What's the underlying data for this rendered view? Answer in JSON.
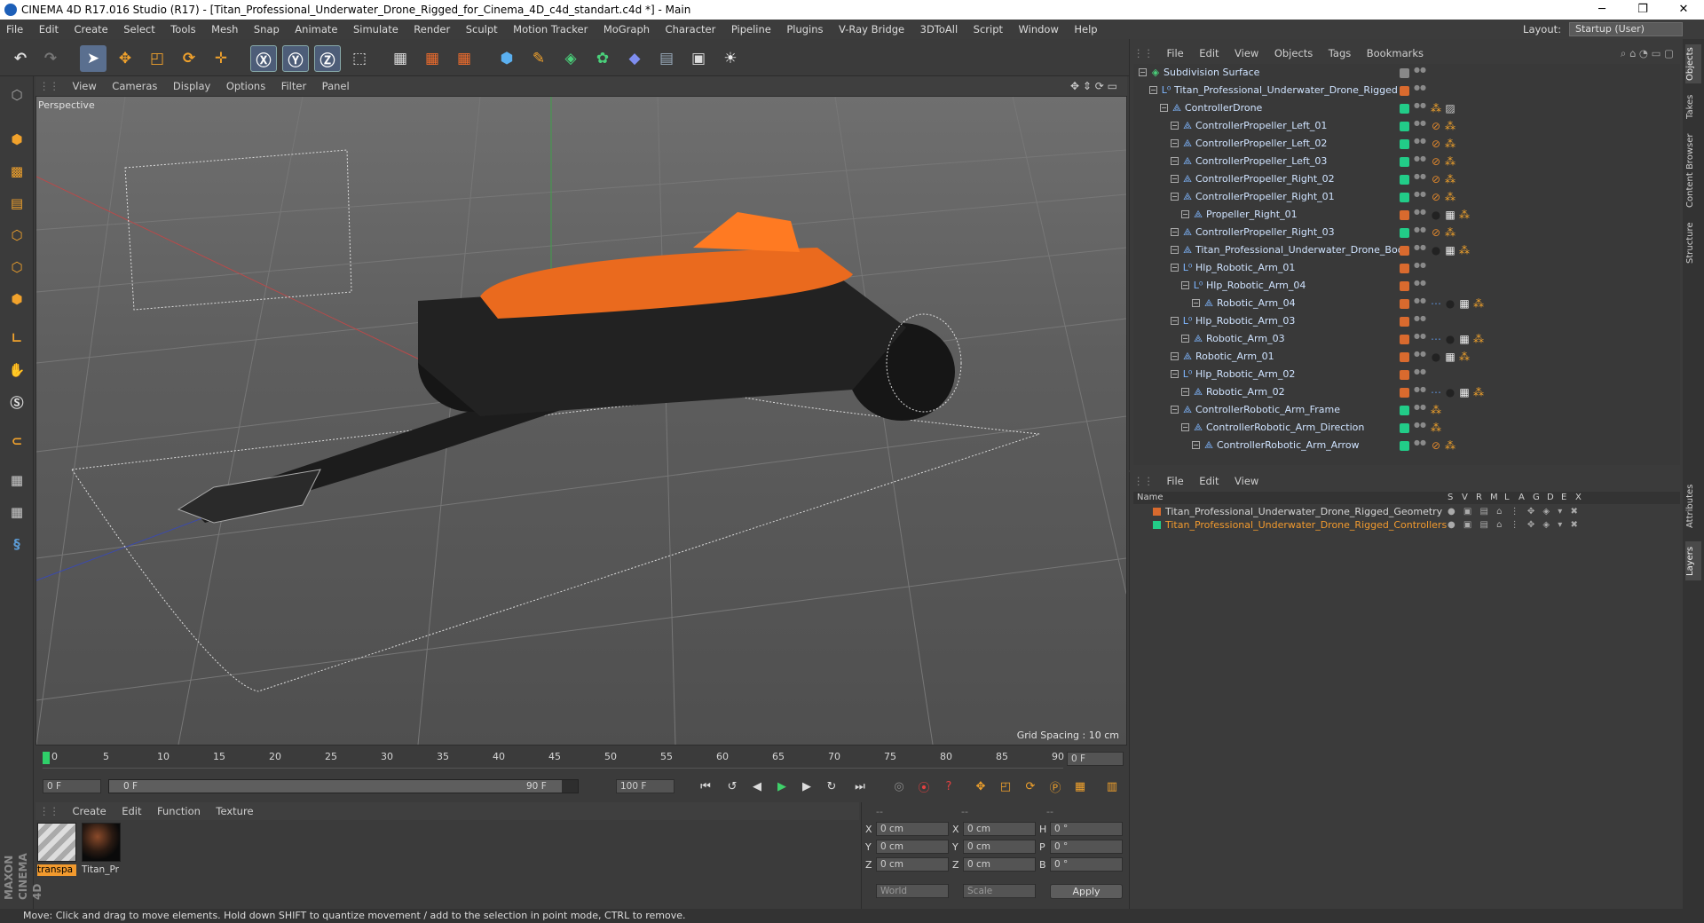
{
  "window": {
    "title": "CINEMA 4D R17.016 Studio (R17) - [Titan_Professional_Underwater_Drone_Rigged_for_Cinema_4D_c4d_standart.c4d *] - Main",
    "minimize": "─",
    "maximize": "❐",
    "close": "✕"
  },
  "menubar": {
    "items": [
      "File",
      "Edit",
      "Create",
      "Select",
      "Tools",
      "Mesh",
      "Snap",
      "Animate",
      "Simulate",
      "Render",
      "Sculpt",
      "Motion Tracker",
      "MoGraph",
      "Character",
      "Pipeline",
      "Plugins",
      "V-Ray Bridge",
      "3DToAll",
      "Script",
      "Window",
      "Help"
    ],
    "layout_label": "Layout:",
    "layout_value": "Startup (User)"
  },
  "viewport": {
    "menu": [
      "View",
      "Cameras",
      "Display",
      "Options",
      "Filter",
      "Panel"
    ],
    "label": "Perspective",
    "grid_spacing": "Grid Spacing : 10 cm"
  },
  "timeline": {
    "ticks": [
      "0",
      "5",
      "10",
      "15",
      "20",
      "25",
      "30",
      "35",
      "40",
      "45",
      "50",
      "55",
      "60",
      "65",
      "70",
      "75",
      "80",
      "85",
      "90"
    ],
    "current_frame": "0 F",
    "start_field": "0 F",
    "range_start": "0 F",
    "range_end": "90 F",
    "end_field": "100 F"
  },
  "materials": {
    "menu": [
      "Create",
      "Edit",
      "Function",
      "Texture"
    ],
    "items": [
      {
        "label": "transpa",
        "selected": true
      },
      {
        "label": "Titan_Pr",
        "selected": false
      }
    ]
  },
  "coords": {
    "headers": [
      "--",
      "--",
      "--"
    ],
    "rows": [
      {
        "a": "X",
        "av": "0 cm",
        "b": "X",
        "bv": "0 cm",
        "c": "H",
        "cv": "0 °"
      },
      {
        "a": "Y",
        "av": "0 cm",
        "b": "Y",
        "bv": "0 cm",
        "c": "P",
        "cv": "0 °"
      },
      {
        "a": "Z",
        "av": "0 cm",
        "b": "Z",
        "bv": "0 cm",
        "c": "B",
        "cv": "0 °"
      }
    ],
    "mode1": "World",
    "mode2": "Scale",
    "apply": "Apply"
  },
  "status": "Move: Click and drag to move elements. Hold down SHIFT to quantize movement / add to the selection in point mode, CTRL to remove.",
  "object_manager": {
    "menu": [
      "File",
      "Edit",
      "View",
      "Objects",
      "Tags",
      "Bookmarks"
    ],
    "rows": [
      {
        "name": "Subdivision Surface",
        "level": 0,
        "icon": "subdivision-icon",
        "color": "#888888",
        "tags": []
      },
      {
        "name": "Titan_Professional_Underwater_Drone_Rigged",
        "level": 1,
        "icon": "null-icon",
        "color": "#d96a2e",
        "tags": []
      },
      {
        "name": "ControllerDrone",
        "level": 2,
        "icon": "joint-icon",
        "color": "#22cc88",
        "tags": [
          "dots",
          "texture"
        ]
      },
      {
        "name": "ControllerPropeller_Left_01",
        "level": 3,
        "icon": "joint-icon",
        "color": "#22cc88",
        "tags": [
          "forbid",
          "dots"
        ]
      },
      {
        "name": "ControllerPropeller_Left_02",
        "level": 3,
        "icon": "joint-icon",
        "color": "#22cc88",
        "tags": [
          "forbid",
          "dots"
        ]
      },
      {
        "name": "ControllerPropeller_Left_03",
        "level": 3,
        "icon": "joint-icon",
        "color": "#22cc88",
        "tags": [
          "forbid",
          "dots"
        ]
      },
      {
        "name": "ControllerPropeller_Right_02",
        "level": 3,
        "icon": "joint-icon",
        "color": "#22cc88",
        "tags": [
          "forbid",
          "dots"
        ]
      },
      {
        "name": "ControllerPropeller_Right_01",
        "level": 3,
        "icon": "joint-icon",
        "color": "#22cc88",
        "tags": [
          "forbid",
          "dots"
        ]
      },
      {
        "name": "Propeller_Right_01",
        "level": 4,
        "icon": "joint-icon",
        "color": "#d96a2e",
        "tags": [
          "material",
          "checker",
          "dots"
        ]
      },
      {
        "name": "ControllerPropeller_Right_03",
        "level": 3,
        "icon": "joint-icon",
        "color": "#22cc88",
        "tags": [
          "forbid",
          "dots"
        ]
      },
      {
        "name": "Titan_Professional_Underwater_Drone_Body",
        "level": 3,
        "icon": "joint-icon",
        "color": "#d96a2e",
        "tags": [
          "material",
          "checker",
          "dots"
        ]
      },
      {
        "name": "Hlp_Robotic_Arm_01",
        "level": 3,
        "icon": "null-icon",
        "color": "#d96a2e",
        "tags": []
      },
      {
        "name": "Hlp_Robotic_Arm_04",
        "level": 4,
        "icon": "null-icon",
        "color": "#d96a2e",
        "tags": []
      },
      {
        "name": "Robotic_Arm_04",
        "level": 5,
        "icon": "joint-icon",
        "color": "#d96a2e",
        "tags": [
          "move",
          "material",
          "checker",
          "dots"
        ]
      },
      {
        "name": "Hlp_Robotic_Arm_03",
        "level": 3,
        "icon": "null-icon",
        "color": "#d96a2e",
        "tags": []
      },
      {
        "name": "Robotic_Arm_03",
        "level": 4,
        "icon": "joint-icon",
        "color": "#d96a2e",
        "tags": [
          "move",
          "material",
          "checker",
          "dots"
        ]
      },
      {
        "name": "Robotic_Arm_01",
        "level": 3,
        "icon": "joint-icon",
        "color": "#d96a2e",
        "tags": [
          "material",
          "checker",
          "dots"
        ]
      },
      {
        "name": "Hlp_Robotic_Arm_02",
        "level": 3,
        "icon": "null-icon",
        "color": "#d96a2e",
        "tags": []
      },
      {
        "name": "Robotic_Arm_02",
        "level": 4,
        "icon": "joint-icon",
        "color": "#d96a2e",
        "tags": [
          "move",
          "material",
          "checker",
          "dots"
        ]
      },
      {
        "name": "ControllerRobotic_Arm_Frame",
        "level": 3,
        "icon": "joint-icon",
        "color": "#22cc88",
        "tags": [
          "dots"
        ]
      },
      {
        "name": "ControllerRobotic_Arm_Direction",
        "level": 4,
        "icon": "joint-icon",
        "color": "#22cc88",
        "tags": [
          "dots"
        ]
      },
      {
        "name": "ControllerRobotic_Arm_Arrow",
        "level": 5,
        "icon": "joint-icon",
        "color": "#22cc88",
        "tags": [
          "forbid",
          "dots"
        ]
      }
    ]
  },
  "layer_manager": {
    "menu": [
      "File",
      "Edit",
      "View"
    ],
    "columns": [
      "Name",
      "S",
      "V",
      "R",
      "M",
      "L",
      "A",
      "G",
      "D",
      "E",
      "X"
    ],
    "layers": [
      {
        "name": "Titan_Professional_Underwater_Drone_Rigged_Geometry",
        "color": "#d96a2e",
        "text_color": "#d6d6d6"
      },
      {
        "name": "Titan_Professional_Underwater_Drone_Rigged_Controllers",
        "color": "#22cc88",
        "text_color": "#f29a2e"
      }
    ]
  },
  "right_tabs": [
    "Objects",
    "Takes",
    "Content Browser",
    "Structure",
    "Attributes",
    "Layers"
  ],
  "brand": {
    "line1": "MAXON",
    "line2": "CINEMA 4D"
  }
}
